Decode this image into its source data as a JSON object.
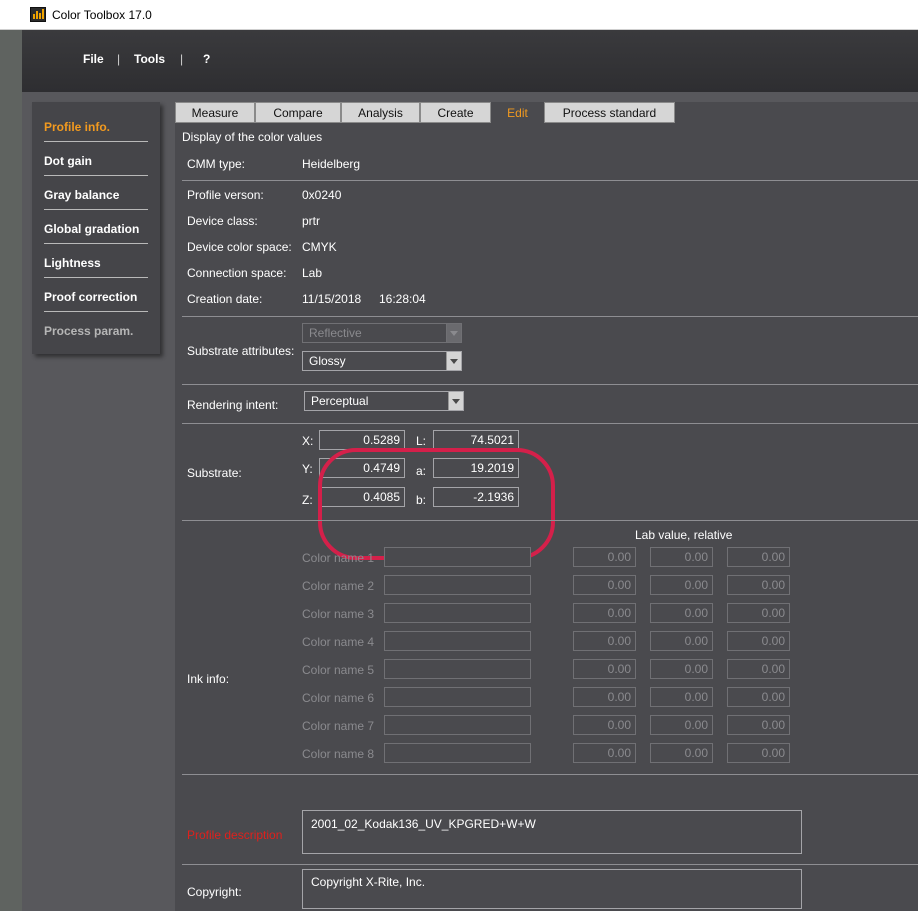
{
  "window": {
    "title": "Color Toolbox 17.0"
  },
  "menu": {
    "file": "File",
    "sep": "|",
    "tools": "Tools",
    "help": "?"
  },
  "sidebar": {
    "items": [
      {
        "label": "Profile info."
      },
      {
        "label": "Dot gain"
      },
      {
        "label": "Gray balance"
      },
      {
        "label": "Global gradation"
      },
      {
        "label": "Lightness"
      },
      {
        "label": "Proof correction"
      },
      {
        "label": "Process param."
      }
    ]
  },
  "tabs": [
    {
      "label": "Measure"
    },
    {
      "label": "Compare"
    },
    {
      "label": "Analysis"
    },
    {
      "label": "Create"
    },
    {
      "label": "Edit"
    },
    {
      "label": "Process standard"
    }
  ],
  "section_title": "Display of the color values",
  "profile": {
    "cmm_type_label": "CMM type:",
    "cmm_type": "Heidelberg",
    "version_label": "Profile verson:",
    "version": "0x0240",
    "device_class_label": "Device class:",
    "device_class": "prtr",
    "device_color_space_label": "Device color space:",
    "device_color_space": "CMYK",
    "connection_space_label": "Connection space:",
    "connection_space": "Lab",
    "creation_date_label": "Creation date:",
    "creation_date": "11/15/2018",
    "creation_time": "16:28:04"
  },
  "substrate_attributes": {
    "label": "Substrate attributes:",
    "reflective": "Reflective",
    "surface": "Glossy"
  },
  "rendering_intent": {
    "label": "Rendering intent:",
    "value": "Perceptual"
  },
  "substrate": {
    "label": "Substrate:",
    "x_label": "X:",
    "x": "0.5289",
    "y_label": "Y:",
    "y": "0.4749",
    "z_label": "Z:",
    "z": "0.4085",
    "l_label": "L:",
    "l": "74.5021",
    "a_label": "a:",
    "a": "19.2019",
    "b_label": "b:",
    "b": "-2.1936"
  },
  "ink_info": {
    "label": "Ink info:",
    "lab_header": "Lab value, relative",
    "rows": [
      {
        "name": "Color name 1",
        "l": "0.00",
        "a": "0.00",
        "b": "0.00"
      },
      {
        "name": "Color name 2",
        "l": "0.00",
        "a": "0.00",
        "b": "0.00"
      },
      {
        "name": "Color name 3",
        "l": "0.00",
        "a": "0.00",
        "b": "0.00"
      },
      {
        "name": "Color name 4",
        "l": "0.00",
        "a": "0.00",
        "b": "0.00"
      },
      {
        "name": "Color name 5",
        "l": "0.00",
        "a": "0.00",
        "b": "0.00"
      },
      {
        "name": "Color name 6",
        "l": "0.00",
        "a": "0.00",
        "b": "0.00"
      },
      {
        "name": "Color name 7",
        "l": "0.00",
        "a": "0.00",
        "b": "0.00"
      },
      {
        "name": "Color name 8",
        "l": "0.00",
        "a": "0.00",
        "b": "0.00"
      }
    ]
  },
  "profile_description": {
    "label": "Profile description",
    "value": "2001_02_Kodak136_UV_KPGRED+W+W"
  },
  "copyright": {
    "label": "Copyright:",
    "value": "Copyright X-Rite, Inc."
  },
  "colors": {
    "accent": "#f29a1f",
    "highlight": "#d4204a",
    "panel": "#4a4a4e"
  }
}
